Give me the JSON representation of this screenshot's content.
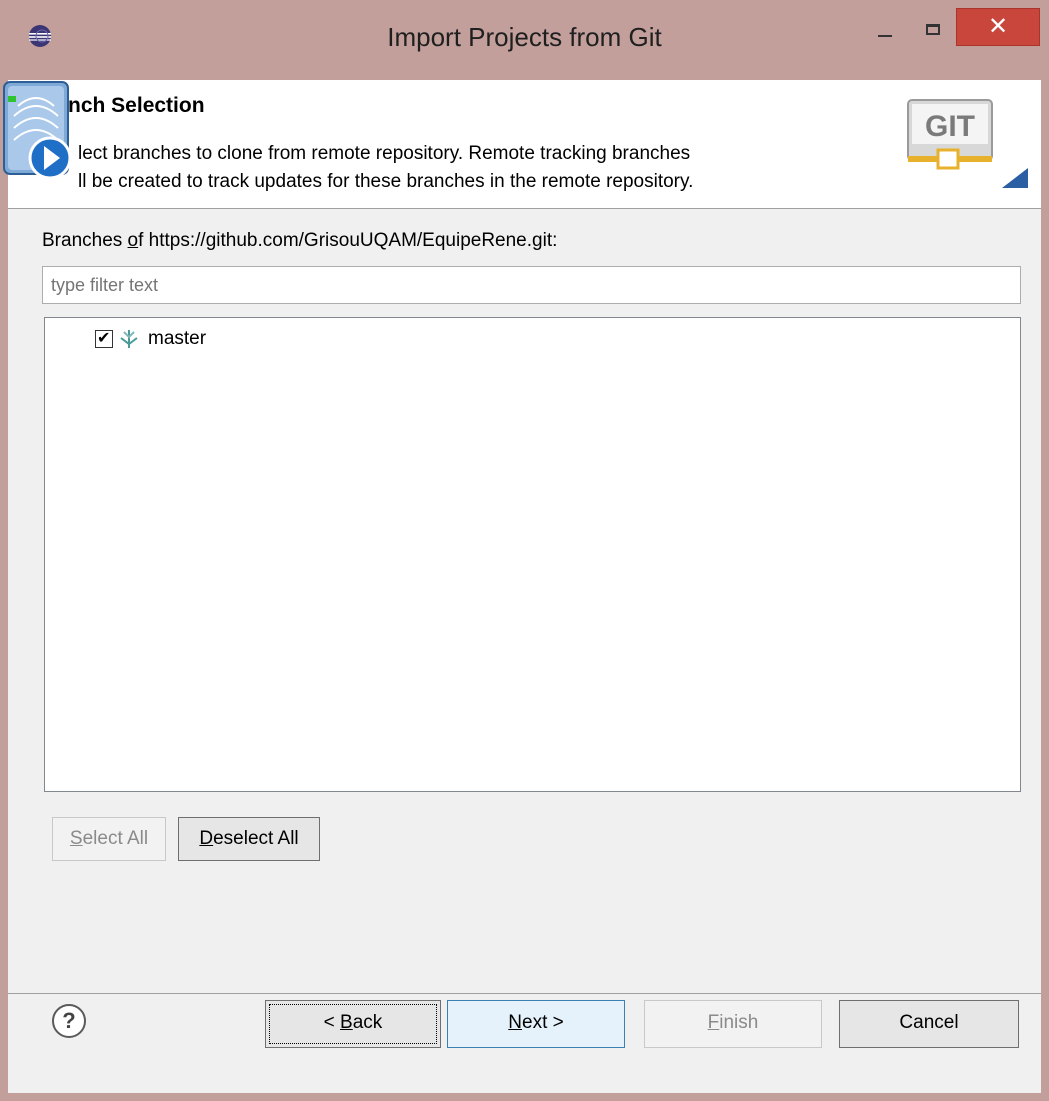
{
  "window": {
    "title": "Import Projects from Git",
    "close_glyph": "✕"
  },
  "banner": {
    "title": "nch Selection",
    "description_line1": "lect branches to clone from remote repository. Remote tracking branches",
    "description_line2": "ll be created to track updates for these branches in the remote repository.",
    "logo_text": "GIT"
  },
  "branches": {
    "label_prefix": "Branches ",
    "label_mnemonic": "o",
    "label_suffix": "f https://github.com/GrisouUQAM/EquipeRene.git:",
    "filter_placeholder": "type filter text",
    "items": [
      {
        "label": "master",
        "checked": true
      }
    ]
  },
  "buttons": {
    "select_all_mnemonic": "S",
    "select_all_rest": "elect All",
    "deselect_all_mnemonic": "D",
    "deselect_all_rest": "eselect All",
    "back_prefix": "< ",
    "back_mnemonic": "B",
    "back_rest": "ack",
    "next_mnemonic": "N",
    "next_rest": "ext >",
    "finish_mnemonic": "F",
    "finish_rest": "inish",
    "cancel": "Cancel",
    "help_glyph": "?"
  },
  "colors": {
    "frame": "#c29f9b",
    "close_button": "#c9463d",
    "accent_blue": "#3c7fb1"
  }
}
